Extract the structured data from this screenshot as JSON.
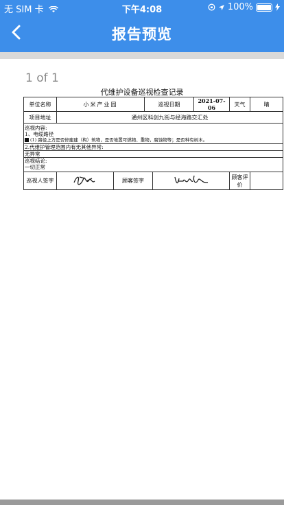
{
  "status_bar": {
    "carrier": "无 SIM 卡",
    "time": "下午4:08",
    "battery": "100%"
  },
  "nav": {
    "title": "报告预览",
    "back_icon": "chevron-left-icon"
  },
  "pdf": {
    "page_indicator": "1 of 1",
    "title": "代维护设备巡视检查记录",
    "row1": {
      "unit_label": "单位名称",
      "unit_value": "小米产业园",
      "date_label": "巡视日期",
      "date_value": "2021-07-06",
      "weather_label": "天气",
      "weather_value": "晴"
    },
    "row2": {
      "address_label": "项目地址",
      "address_value": "通州区科创九街与经海路交汇处"
    },
    "content": {
      "line1": "巡视内容:",
      "line2": "1、电缆路径",
      "line3": "(1) 路径上方是否修建建（构）筑物，是否堆置可燃物、重物，腐蚀物等；是否种有树木。",
      "line4": "2.代维护管理范围内有无其他异常:",
      "line5": "无异常",
      "line6": "巡视结论:",
      "line7": "一切正常"
    },
    "sign_row": {
      "inspector_label": "巡视人签字",
      "customer_sign_label": "顾客签字",
      "customer_rating_label": "顾客评价"
    }
  },
  "colors": {
    "header_blue": "#3d8eea"
  }
}
